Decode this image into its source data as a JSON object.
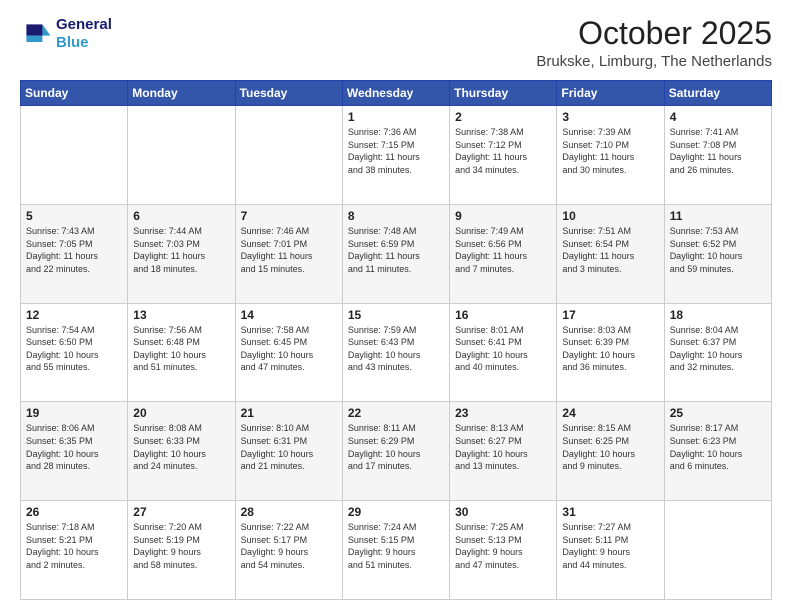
{
  "logo": {
    "line1": "General",
    "line2": "Blue"
  },
  "title": "October 2025",
  "location": "Brukske, Limburg, The Netherlands",
  "days_of_week": [
    "Sunday",
    "Monday",
    "Tuesday",
    "Wednesday",
    "Thursday",
    "Friday",
    "Saturday"
  ],
  "weeks": [
    [
      {
        "day": "",
        "info": ""
      },
      {
        "day": "",
        "info": ""
      },
      {
        "day": "",
        "info": ""
      },
      {
        "day": "1",
        "info": "Sunrise: 7:36 AM\nSunset: 7:15 PM\nDaylight: 11 hours\nand 38 minutes."
      },
      {
        "day": "2",
        "info": "Sunrise: 7:38 AM\nSunset: 7:12 PM\nDaylight: 11 hours\nand 34 minutes."
      },
      {
        "day": "3",
        "info": "Sunrise: 7:39 AM\nSunset: 7:10 PM\nDaylight: 11 hours\nand 30 minutes."
      },
      {
        "day": "4",
        "info": "Sunrise: 7:41 AM\nSunset: 7:08 PM\nDaylight: 11 hours\nand 26 minutes."
      }
    ],
    [
      {
        "day": "5",
        "info": "Sunrise: 7:43 AM\nSunset: 7:05 PM\nDaylight: 11 hours\nand 22 minutes."
      },
      {
        "day": "6",
        "info": "Sunrise: 7:44 AM\nSunset: 7:03 PM\nDaylight: 11 hours\nand 18 minutes."
      },
      {
        "day": "7",
        "info": "Sunrise: 7:46 AM\nSunset: 7:01 PM\nDaylight: 11 hours\nand 15 minutes."
      },
      {
        "day": "8",
        "info": "Sunrise: 7:48 AM\nSunset: 6:59 PM\nDaylight: 11 hours\nand 11 minutes."
      },
      {
        "day": "9",
        "info": "Sunrise: 7:49 AM\nSunset: 6:56 PM\nDaylight: 11 hours\nand 7 minutes."
      },
      {
        "day": "10",
        "info": "Sunrise: 7:51 AM\nSunset: 6:54 PM\nDaylight: 11 hours\nand 3 minutes."
      },
      {
        "day": "11",
        "info": "Sunrise: 7:53 AM\nSunset: 6:52 PM\nDaylight: 10 hours\nand 59 minutes."
      }
    ],
    [
      {
        "day": "12",
        "info": "Sunrise: 7:54 AM\nSunset: 6:50 PM\nDaylight: 10 hours\nand 55 minutes."
      },
      {
        "day": "13",
        "info": "Sunrise: 7:56 AM\nSunset: 6:48 PM\nDaylight: 10 hours\nand 51 minutes."
      },
      {
        "day": "14",
        "info": "Sunrise: 7:58 AM\nSunset: 6:45 PM\nDaylight: 10 hours\nand 47 minutes."
      },
      {
        "day": "15",
        "info": "Sunrise: 7:59 AM\nSunset: 6:43 PM\nDaylight: 10 hours\nand 43 minutes."
      },
      {
        "day": "16",
        "info": "Sunrise: 8:01 AM\nSunset: 6:41 PM\nDaylight: 10 hours\nand 40 minutes."
      },
      {
        "day": "17",
        "info": "Sunrise: 8:03 AM\nSunset: 6:39 PM\nDaylight: 10 hours\nand 36 minutes."
      },
      {
        "day": "18",
        "info": "Sunrise: 8:04 AM\nSunset: 6:37 PM\nDaylight: 10 hours\nand 32 minutes."
      }
    ],
    [
      {
        "day": "19",
        "info": "Sunrise: 8:06 AM\nSunset: 6:35 PM\nDaylight: 10 hours\nand 28 minutes."
      },
      {
        "day": "20",
        "info": "Sunrise: 8:08 AM\nSunset: 6:33 PM\nDaylight: 10 hours\nand 24 minutes."
      },
      {
        "day": "21",
        "info": "Sunrise: 8:10 AM\nSunset: 6:31 PM\nDaylight: 10 hours\nand 21 minutes."
      },
      {
        "day": "22",
        "info": "Sunrise: 8:11 AM\nSunset: 6:29 PM\nDaylight: 10 hours\nand 17 minutes."
      },
      {
        "day": "23",
        "info": "Sunrise: 8:13 AM\nSunset: 6:27 PM\nDaylight: 10 hours\nand 13 minutes."
      },
      {
        "day": "24",
        "info": "Sunrise: 8:15 AM\nSunset: 6:25 PM\nDaylight: 10 hours\nand 9 minutes."
      },
      {
        "day": "25",
        "info": "Sunrise: 8:17 AM\nSunset: 6:23 PM\nDaylight: 10 hours\nand 6 minutes."
      }
    ],
    [
      {
        "day": "26",
        "info": "Sunrise: 7:18 AM\nSunset: 5:21 PM\nDaylight: 10 hours\nand 2 minutes."
      },
      {
        "day": "27",
        "info": "Sunrise: 7:20 AM\nSunset: 5:19 PM\nDaylight: 9 hours\nand 58 minutes."
      },
      {
        "day": "28",
        "info": "Sunrise: 7:22 AM\nSunset: 5:17 PM\nDaylight: 9 hours\nand 54 minutes."
      },
      {
        "day": "29",
        "info": "Sunrise: 7:24 AM\nSunset: 5:15 PM\nDaylight: 9 hours\nand 51 minutes."
      },
      {
        "day": "30",
        "info": "Sunrise: 7:25 AM\nSunset: 5:13 PM\nDaylight: 9 hours\nand 47 minutes."
      },
      {
        "day": "31",
        "info": "Sunrise: 7:27 AM\nSunset: 5:11 PM\nDaylight: 9 hours\nand 44 minutes."
      },
      {
        "day": "",
        "info": ""
      }
    ]
  ]
}
